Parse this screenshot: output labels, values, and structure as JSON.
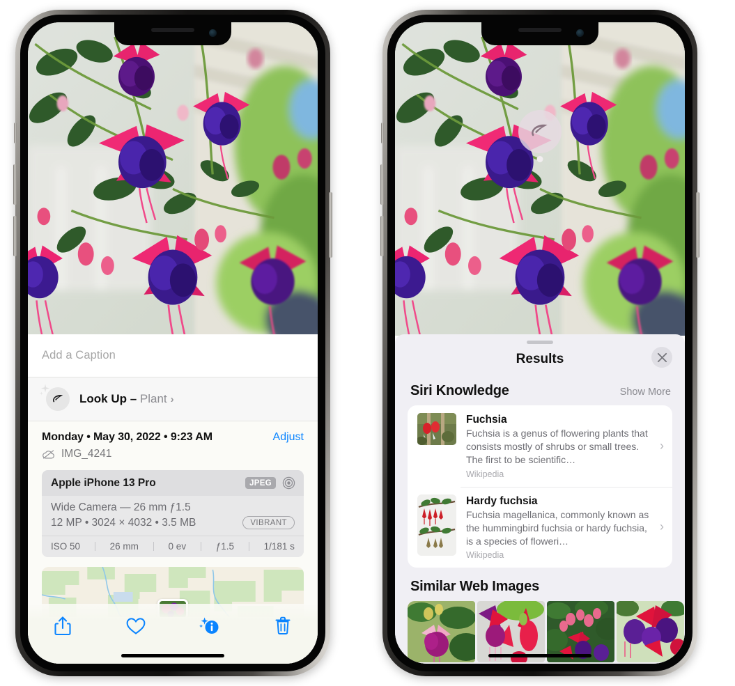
{
  "meta": {
    "accent_blue": "#0a84ff",
    "sheet_bg": "#f0eff4",
    "card_bg": "#ffffff"
  },
  "left_phone": {
    "name": "photos-info-screen",
    "caption": {
      "placeholder": "Add a Caption",
      "value": ""
    },
    "lookup": {
      "icon": "leaf-icon",
      "label": "Look Up",
      "dash": " – ",
      "subject": "Plant",
      "chevron": "›"
    },
    "details": {
      "date": "Monday • May 30, 2022 • 9:23 AM",
      "adjust_label": "Adjust",
      "cloud_icon": "icloud-slash-icon",
      "filename": "IMG_4241"
    },
    "camera_card": {
      "device": "Apple iPhone 13 Pro",
      "format_badge": "JPEG",
      "raw_icon": "aperture-icon",
      "lens_line": "Wide Camera — 26 mm ƒ1.5",
      "spec_line": "12 MP • 3024 × 4032 • 3.5 MB",
      "style_badge": "VIBRANT",
      "exif": [
        "ISO 50",
        "26 mm",
        "0 ev",
        "ƒ1.5",
        "1/181 s"
      ]
    },
    "map": {
      "name": "location-map-strip",
      "pin": "photo-thumbnail-pin"
    },
    "toolbar": [
      {
        "name": "share-button",
        "icon": "share-icon"
      },
      {
        "name": "favorite-button",
        "icon": "heart-icon"
      },
      {
        "name": "info-button",
        "icon": "info-sparkle-icon"
      },
      {
        "name": "delete-button",
        "icon": "trash-icon"
      }
    ]
  },
  "right_phone": {
    "name": "visual-lookup-results-screen",
    "photo_badge": {
      "name": "visual-lookup-leaf-badge",
      "icon": "leaf-icon"
    },
    "sheet": {
      "title": "Results",
      "close_icon": "close-icon",
      "sections": [
        {
          "title": "Siri Knowledge",
          "action": "Show More",
          "items": [
            {
              "title": "Fuchsia",
              "desc": "Fuchsia is a genus of flowering plants that consists mostly of shrubs or small trees. The first to be scientific…",
              "source": "Wikipedia",
              "chevron": "›"
            },
            {
              "title": "Hardy fuchsia",
              "desc": "Fuchsia magellanica, commonly known as the hummingbird fuchsia or hardy fuchsia, is a species of floweri…",
              "source": "Wikipedia",
              "chevron": "›"
            }
          ]
        },
        {
          "title": "Similar Web Images",
          "thumbs": [
            {
              "name": "web-image-1"
            },
            {
              "name": "web-image-2"
            },
            {
              "name": "web-image-3"
            },
            {
              "name": "web-image-4"
            }
          ]
        }
      ]
    }
  }
}
